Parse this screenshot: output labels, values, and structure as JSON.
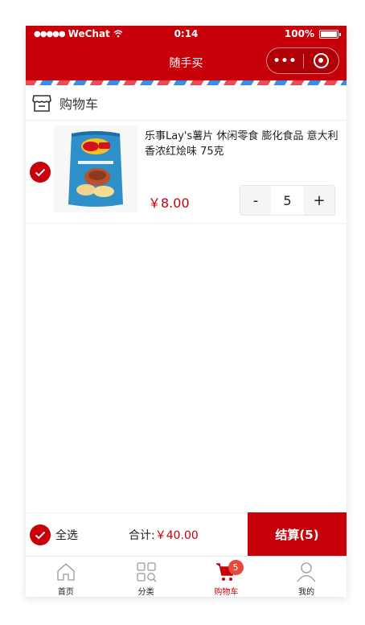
{
  "status_bar": {
    "carrier": "WeChat",
    "time": "0:14",
    "battery": "100%"
  },
  "navbar": {
    "title": "随手买",
    "more_icon": "ellipsis-icon",
    "close_icon": "target-icon"
  },
  "cart": {
    "title": "购物车",
    "items": [
      {
        "name": "乐事Lay's薯片 休闲零食 膨化食品 意大利香浓红烩味 75克",
        "price": "￥8.00",
        "quantity": "5",
        "minus_label": "-",
        "plus_label": "+",
        "selected": true
      }
    ]
  },
  "summary": {
    "select_all_label": "全选",
    "total_label": "合计:",
    "total_value": "￥40.00",
    "checkout_label": "结算(5)"
  },
  "tabbar": {
    "tabs": [
      {
        "label": "首页",
        "icon": "home-icon"
      },
      {
        "label": "分类",
        "icon": "category-icon"
      },
      {
        "label": "购物车",
        "icon": "cart-icon",
        "badge": "5",
        "active": true
      },
      {
        "label": "我的",
        "icon": "user-icon"
      }
    ]
  },
  "colors": {
    "brand": "#c8000a",
    "badge": "#e8473b"
  }
}
